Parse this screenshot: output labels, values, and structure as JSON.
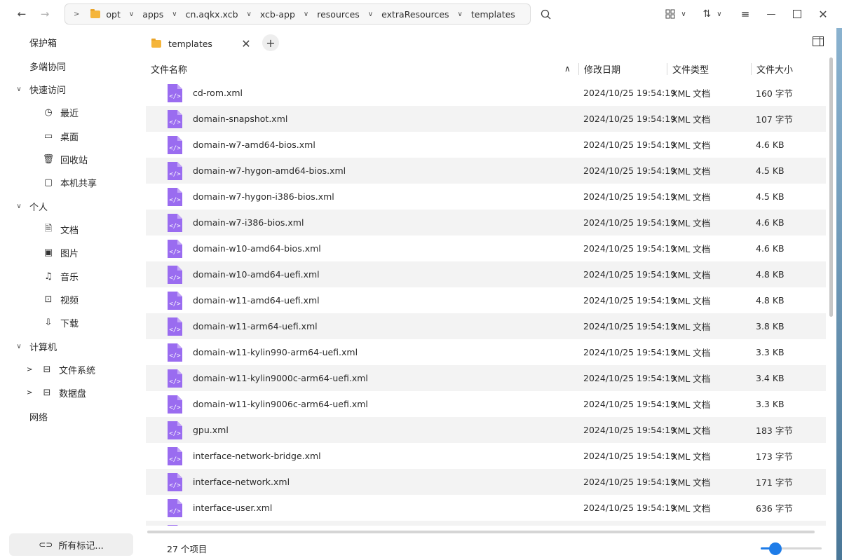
{
  "toolbar": {
    "back_icon": "arrow-left-icon",
    "forward_icon": "arrow-right-icon",
    "breadcrumb": [
      "opt",
      "apps",
      "cn.aqkx.xcb",
      "xcb-app",
      "resources",
      "extraResources",
      "templates"
    ]
  },
  "sidebar": {
    "items": [
      {
        "label": "保护箱"
      },
      {
        "label": "多端协同"
      },
      {
        "label": "快速访问"
      },
      {
        "label": "最近"
      },
      {
        "label": "桌面"
      },
      {
        "label": "回收站"
      },
      {
        "label": "本机共享"
      },
      {
        "label": "个人"
      },
      {
        "label": "文档"
      },
      {
        "label": "图片"
      },
      {
        "label": "音乐"
      },
      {
        "label": "视频"
      },
      {
        "label": "下载"
      },
      {
        "label": "计算机"
      },
      {
        "label": "文件系统"
      },
      {
        "label": "数据盘"
      },
      {
        "label": "网络"
      }
    ],
    "all_tags": "所有标记..."
  },
  "tab": {
    "label": "templates"
  },
  "columns": {
    "name": "文件名称",
    "date": "修改日期",
    "type": "文件类型",
    "size": "文件大小"
  },
  "files": [
    {
      "name": "cd-rom.xml",
      "date": "2024/10/25 19:54:19",
      "type": "XML 文档",
      "size": "160 字节"
    },
    {
      "name": "domain-snapshot.xml",
      "date": "2024/10/25 19:54:19",
      "type": "XML 文档",
      "size": "107 字节"
    },
    {
      "name": "domain-w7-amd64-bios.xml",
      "date": "2024/10/25 19:54:19",
      "type": "XML 文档",
      "size": "4.6 KB"
    },
    {
      "name": "domain-w7-hygon-amd64-bios.xml",
      "date": "2024/10/25 19:54:19",
      "type": "XML 文档",
      "size": "4.5 KB"
    },
    {
      "name": "domain-w7-hygon-i386-bios.xml",
      "date": "2024/10/25 19:54:19",
      "type": "XML 文档",
      "size": "4.5 KB"
    },
    {
      "name": "domain-w7-i386-bios.xml",
      "date": "2024/10/25 19:54:19",
      "type": "XML 文档",
      "size": "4.6 KB"
    },
    {
      "name": "domain-w10-amd64-bios.xml",
      "date": "2024/10/25 19:54:19",
      "type": "XML 文档",
      "size": "4.6 KB"
    },
    {
      "name": "domain-w10-amd64-uefi.xml",
      "date": "2024/10/25 19:54:19",
      "type": "XML 文档",
      "size": "4.8 KB"
    },
    {
      "name": "domain-w11-amd64-uefi.xml",
      "date": "2024/10/25 19:54:19",
      "type": "XML 文档",
      "size": "4.8 KB"
    },
    {
      "name": "domain-w11-arm64-uefi.xml",
      "date": "2024/10/25 19:54:19",
      "type": "XML 文档",
      "size": "3.8 KB"
    },
    {
      "name": "domain-w11-kylin990-arm64-uefi.xml",
      "date": "2024/10/25 19:54:19",
      "type": "XML 文档",
      "size": "3.3 KB"
    },
    {
      "name": "domain-w11-kylin9000c-arm64-uefi.xml",
      "date": "2024/10/25 19:54:19",
      "type": "XML 文档",
      "size": "3.4 KB"
    },
    {
      "name": "domain-w11-kylin9006c-arm64-uefi.xml",
      "date": "2024/10/25 19:54:19",
      "type": "XML 文档",
      "size": "3.3 KB"
    },
    {
      "name": "gpu.xml",
      "date": "2024/10/25 19:54:19",
      "type": "XML 文档",
      "size": "183 字节"
    },
    {
      "name": "interface-network-bridge.xml",
      "date": "2024/10/25 19:54:19",
      "type": "XML 文档",
      "size": "173 字节"
    },
    {
      "name": "interface-network.xml",
      "date": "2024/10/25 19:54:19",
      "type": "XML 文档",
      "size": "171 字节"
    },
    {
      "name": "interface-user.xml",
      "date": "2024/10/25 19:54:19",
      "type": "XML 文档",
      "size": "636 字节"
    }
  ],
  "status": {
    "count": "27 个项目"
  },
  "colors": {
    "accent": "#1e7ce8",
    "folder": "#f5b53a",
    "file_icon": "#9a6cf0"
  }
}
